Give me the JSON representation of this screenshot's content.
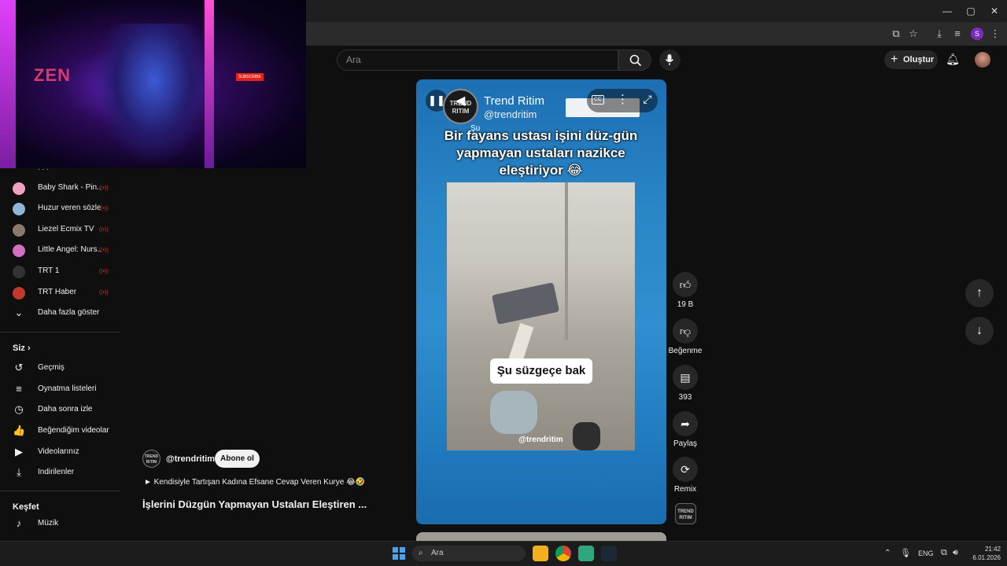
{
  "window": {
    "minimize": "—",
    "maximize": "▢",
    "close": "✕"
  },
  "header": {
    "search_placeholder": "Ara",
    "create_label": "Oluştur"
  },
  "overlay": {
    "brand": "ZEN",
    "subscribe": "SUBSCRIBE"
  },
  "sidebar": {
    "subscriptions": [
      {
        "label": "Baby Shark - Pin...",
        "color": "#f0a0c0"
      },
      {
        "label": "Huzur veren sözler",
        "color": "#8fb6d8"
      },
      {
        "label": "Liezel Ecmix TV",
        "color": "#8a7a6a"
      },
      {
        "label": "Little Angel: Nurs...",
        "color": "#d070c0"
      },
      {
        "label": "TRT 1",
        "color": "#333333"
      },
      {
        "label": "TRT Haber",
        "color": "#c0392b"
      }
    ],
    "show_more": "Daha fazla göster",
    "you_title": "Siz",
    "you_items": [
      {
        "label": "Geçmiş",
        "icon": "history-icon",
        "glyph": "↺"
      },
      {
        "label": "Oynatma listeleri",
        "icon": "playlists-icon",
        "glyph": "≡"
      },
      {
        "label": "Daha sonra izle",
        "icon": "watch-later-icon",
        "glyph": "◷"
      },
      {
        "label": "Beğendiğim videolar",
        "icon": "liked-icon",
        "glyph": "👍"
      },
      {
        "label": "Videolarınız",
        "icon": "your-videos-icon",
        "glyph": "▶"
      },
      {
        "label": "İndirilenler",
        "icon": "downloads-icon",
        "glyph": "⤓"
      }
    ],
    "explore_title": "Keşfet",
    "explore_items": [
      {
        "label": "Müzik",
        "icon": "music-icon",
        "glyph": "♪"
      }
    ]
  },
  "video": {
    "channel_name": "Trend Ritim",
    "channel_handle": "@trendritim",
    "logo_text": "TREND RITIM",
    "headline": "Bir fayans ustası işini düz-gün yapmayan ustaları nazikce eleştiriyor 😂",
    "caption": "Şu süzgeçe bak",
    "watermark": "@trendritim",
    "overlay_word": "Şu"
  },
  "actions": {
    "likes": "19 B",
    "dislike_label": "Beğenme",
    "comments": "393",
    "share_label": "Paylaş",
    "remix_label": "Remix"
  },
  "meta": {
    "handle": "@trendritim",
    "subscribe": "Abone ol",
    "related": "► Kendisiyle Tartışan Kadına Efsane Cevap Veren Kurye 😂🤣",
    "title": "İşlerini Düzgün Yapmayan Ustaları Eleştiren ..."
  },
  "taskbar": {
    "search": "Ara",
    "lang": "ENG",
    "time": "21:42",
    "date": "6.01.2026"
  }
}
